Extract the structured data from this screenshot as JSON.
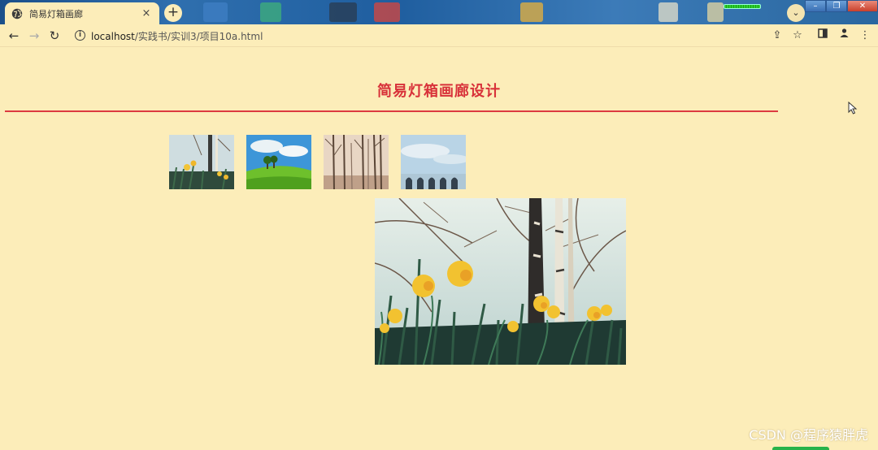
{
  "browser": {
    "tab_title": "简易灯箱画廊",
    "tab_close": "×",
    "new_tab": "+",
    "url_host": "localhost",
    "url_path": "/实践书/实训3/项目10a.html",
    "nav": {
      "back": "←",
      "forward": "→",
      "reload": "↻"
    },
    "window_buttons": {
      "minimize": "–",
      "restore": "❐",
      "close": "✕"
    }
  },
  "page": {
    "heading": "简易灯箱画廊设计",
    "thumbnails": [
      {
        "name": "daffodils-thumb",
        "icon": "daffodils-birch-image"
      },
      {
        "name": "meadow-thumb",
        "icon": "green-meadow-trees-image"
      },
      {
        "name": "forest-thumb",
        "icon": "misty-forest-image"
      },
      {
        "name": "arches-thumb",
        "icon": "sky-arches-image"
      }
    ],
    "main_image": {
      "icon": "daffodils-birch-image"
    }
  },
  "watermark": "CSDN @程序猿胖虎",
  "colors": {
    "background": "#fcedb9",
    "heading": "#d8323a",
    "rule": "#dc3a40"
  }
}
